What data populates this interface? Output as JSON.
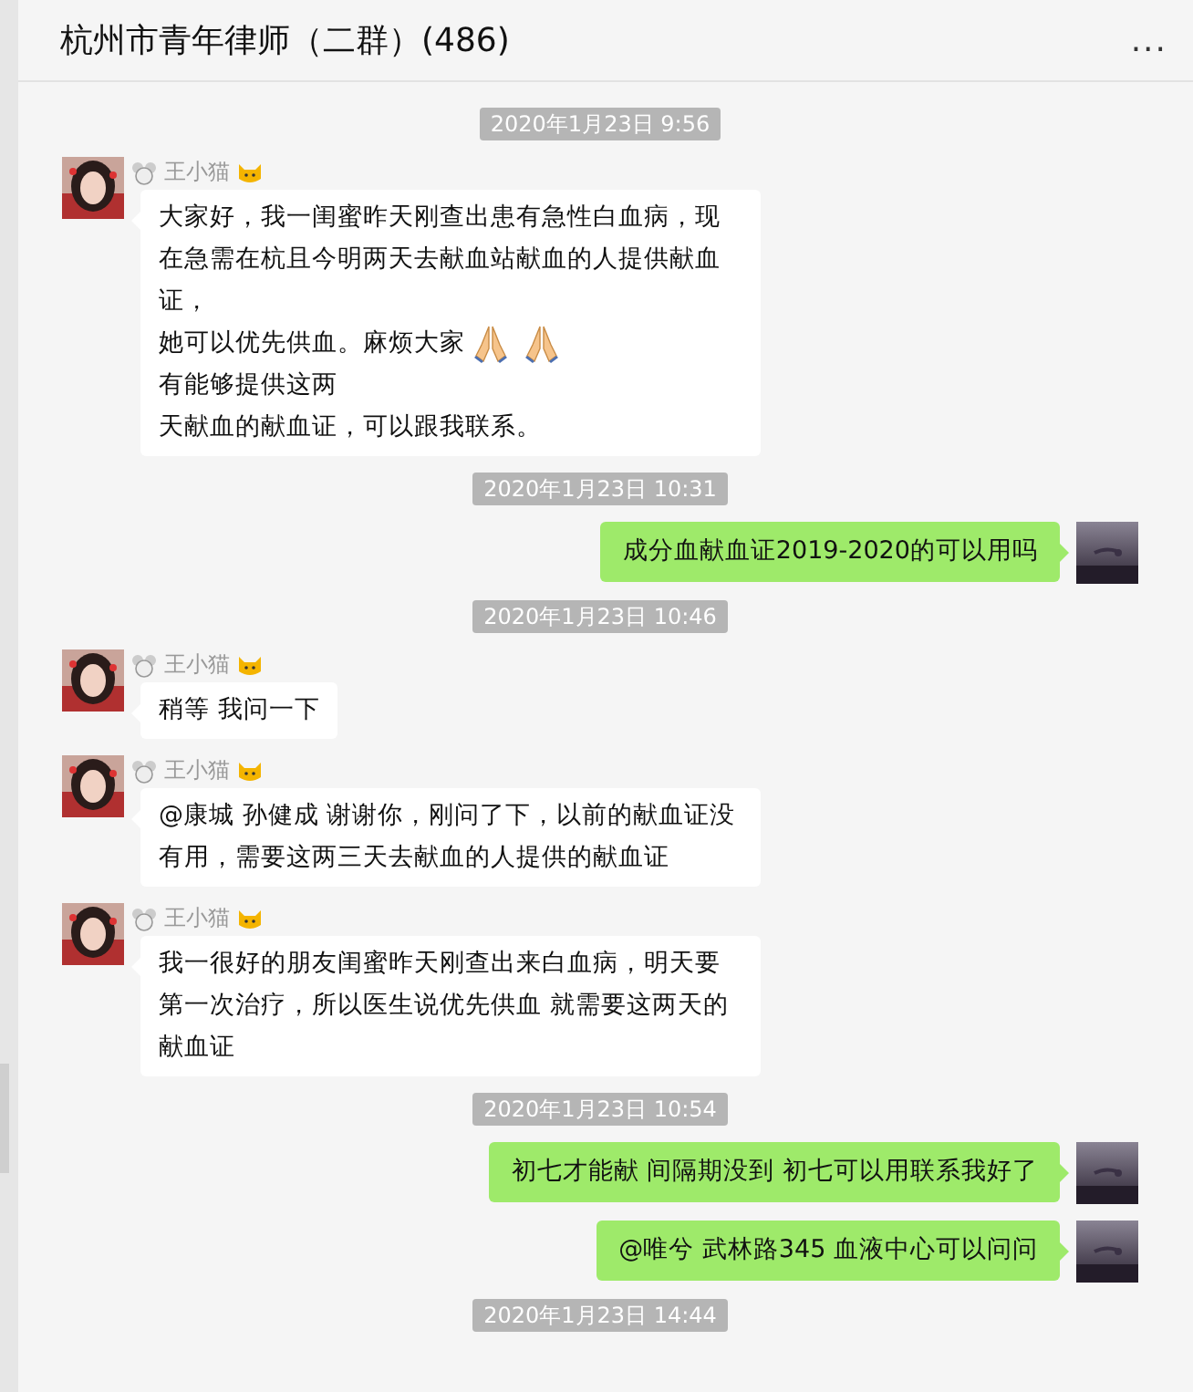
{
  "window": {
    "title": "杭州市青年律师（二群）(486)",
    "menu": "..."
  },
  "messages": [
    {
      "kind": "time",
      "text": "2020年1月23日 9:56"
    },
    {
      "kind": "left",
      "sender": "王小猫",
      "lines": [
        [
          {
            "kind": "text",
            "text": "大家好，我一闺蜜昨天刚查出患有急性白血病，现在急需在杭且今明两天去献血站献血的人提供献血证，"
          }
        ],
        [
          {
            "kind": "text",
            "text": "她可以优先供血。麻烦大家"
          },
          {
            "kind": "pray"
          },
          {
            "kind": "pray"
          },
          {
            "kind": "text",
            "text": "有能够提供这两"
          }
        ],
        [
          {
            "kind": "text",
            "text": "天献血的献血证，可以跟我联系。"
          }
        ]
      ]
    },
    {
      "kind": "time",
      "text": "2020年1月23日 10:31"
    },
    {
      "kind": "right",
      "lines": [
        [
          {
            "kind": "text",
            "text": "成分血献血证2019-2020的可以用吗"
          }
        ]
      ]
    },
    {
      "kind": "time",
      "text": "2020年1月23日 10:46"
    },
    {
      "kind": "left",
      "sender": "王小猫",
      "lines": [
        [
          {
            "kind": "text",
            "text": "稍等 我问一下"
          }
        ]
      ]
    },
    {
      "kind": "left",
      "sender": "王小猫",
      "lines": [
        [
          {
            "kind": "text",
            "text": "@康城 孙健成 谢谢你，刚问了下，以前的献血证没有用，需要这两三天去献血的人提供的献血证"
          }
        ]
      ]
    },
    {
      "kind": "left",
      "sender": "王小猫",
      "lines": [
        [
          {
            "kind": "text",
            "text": "我一很好的朋友闺蜜昨天刚查出来白血病，明天要第一次治疗，所以医生说优先供血 就需要这两天的献血证"
          }
        ]
      ]
    },
    {
      "kind": "time",
      "text": "2020年1月23日 10:54"
    },
    {
      "kind": "right",
      "lines": [
        [
          {
            "kind": "text",
            "text": "初七才能献 间隔期没到 初七可以用联系我好了"
          }
        ]
      ]
    },
    {
      "kind": "right",
      "lines": [
        [
          {
            "kind": "text",
            "text": "@唯兮 武林路345 血液中心可以问问"
          }
        ]
      ]
    },
    {
      "kind": "time",
      "text": "2020年1月23日 14:44"
    }
  ]
}
